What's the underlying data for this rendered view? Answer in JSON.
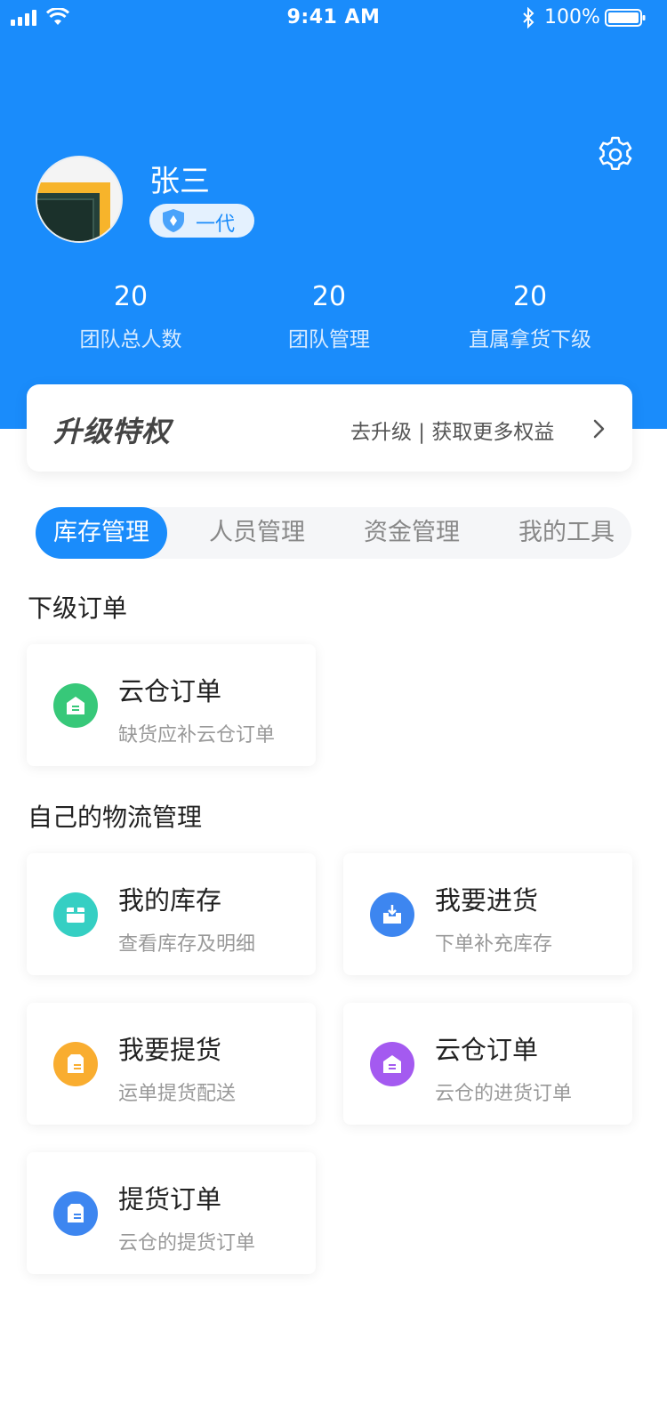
{
  "status_bar": {
    "time": "9:41 AM",
    "battery": "100%"
  },
  "profile": {
    "name": "张三",
    "level": "一代"
  },
  "stats": [
    {
      "value": "20",
      "label": "团队总人数"
    },
    {
      "value": "20",
      "label": "团队管理"
    },
    {
      "value": "20",
      "label": "直属拿货下级"
    }
  ],
  "upgrade": {
    "title": "升级特权",
    "link": "去升级 | 获取更多权益"
  },
  "tabs": [
    {
      "label": "库存管理",
      "active": true
    },
    {
      "label": "人员管理",
      "active": false
    },
    {
      "label": "资金管理",
      "active": false
    },
    {
      "label": "我的工具",
      "active": false
    }
  ],
  "sections": {
    "sub_orders": {
      "title": "下级订单",
      "cards": [
        {
          "title": "云仓订单",
          "sub": "缺货应补云仓订单",
          "icon": "cloud-warehouse-icon",
          "color": "#37c879"
        }
      ]
    },
    "logistics": {
      "title": "自己的物流管理",
      "cards": [
        {
          "title": "我的库存",
          "sub": "查看库存及明细",
          "icon": "inventory-box-icon",
          "color": "#35cfc3"
        },
        {
          "title": "我要进货",
          "sub": "下单补充库存",
          "icon": "restock-download-icon",
          "color": "#3d86f0"
        },
        {
          "title": "我要提货",
          "sub": "运单提货配送",
          "icon": "pickup-box-icon",
          "color": "#f9ad30"
        },
        {
          "title": "云仓订单",
          "sub": "云仓的进货订单",
          "icon": "cloud-order-icon",
          "color": "#a45af0"
        },
        {
          "title": "提货订单",
          "sub": "云仓的提货订单",
          "icon": "pickup-order-icon",
          "color": "#3d86f0"
        }
      ]
    }
  },
  "colors": {
    "primary": "#1a8cfb"
  }
}
